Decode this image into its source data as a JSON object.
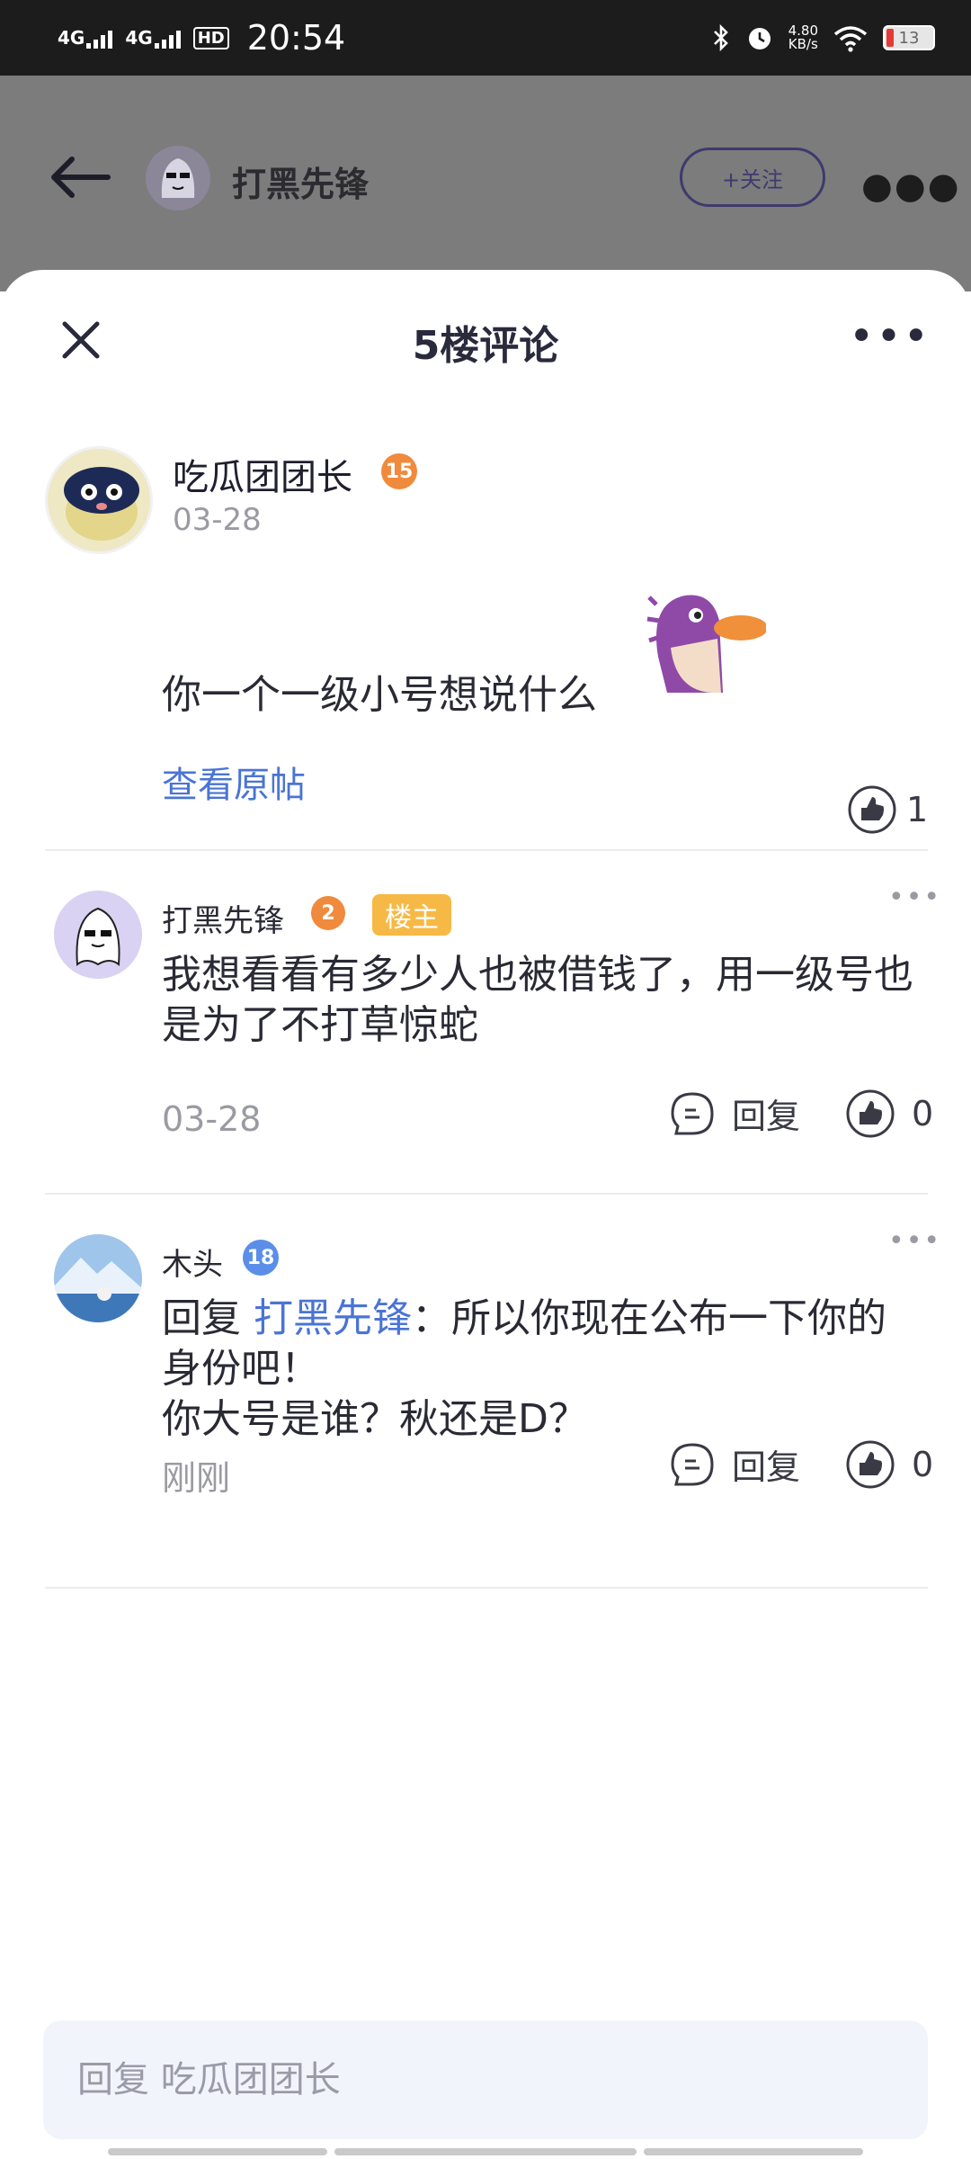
{
  "status_bar": {
    "network1": "4G",
    "network2": "4G",
    "hd": "HD",
    "time": "20:54",
    "speed_value": "4.80",
    "speed_unit": "KB/s",
    "battery": "13",
    "icons": [
      "bluetooth-icon",
      "alarm-icon",
      "wifi-icon",
      "battery-icon"
    ]
  },
  "header": {
    "back_icon": "arrow-left-icon",
    "username": "打黑先锋",
    "follow_label": "+关注",
    "more_icon": "more-icon"
  },
  "sheet": {
    "title": "5楼评论",
    "close_icon": "close-icon",
    "more_icon": "more-icon"
  },
  "main_comment": {
    "username": "吃瓜团团长",
    "level": "15",
    "date": "03-28",
    "text": "你一个一级小号想说什么",
    "sticker": "platypus-sticker",
    "view_post_label": "查看原帖",
    "likes": "1"
  },
  "replies": [
    {
      "username": "打黑先锋",
      "level": "2",
      "owner_tag": "楼主",
      "text": "我想看看有多少人也被借钱了，用一级号也是为了不打草惊蛇",
      "date": "03-28",
      "reply_label": "回复",
      "likes": "0"
    },
    {
      "username": "木头",
      "level": "18",
      "reply_prefix": "回复",
      "mention": "打黑先锋",
      "text": "：所以你现在公布一下你的身份吧！\n你大号是谁？秋还是D？",
      "date": "刚刚",
      "reply_label": "回复",
      "likes": "0"
    }
  ],
  "reply_input": {
    "placeholder": "回复 吃瓜团团长"
  },
  "colors": {
    "link": "#4a74d4",
    "owner_tag": "#f7b945",
    "level_orange": "#f08a3c",
    "level_blue": "#5b8ee8",
    "dim_overlay": "#7c7c7c"
  }
}
